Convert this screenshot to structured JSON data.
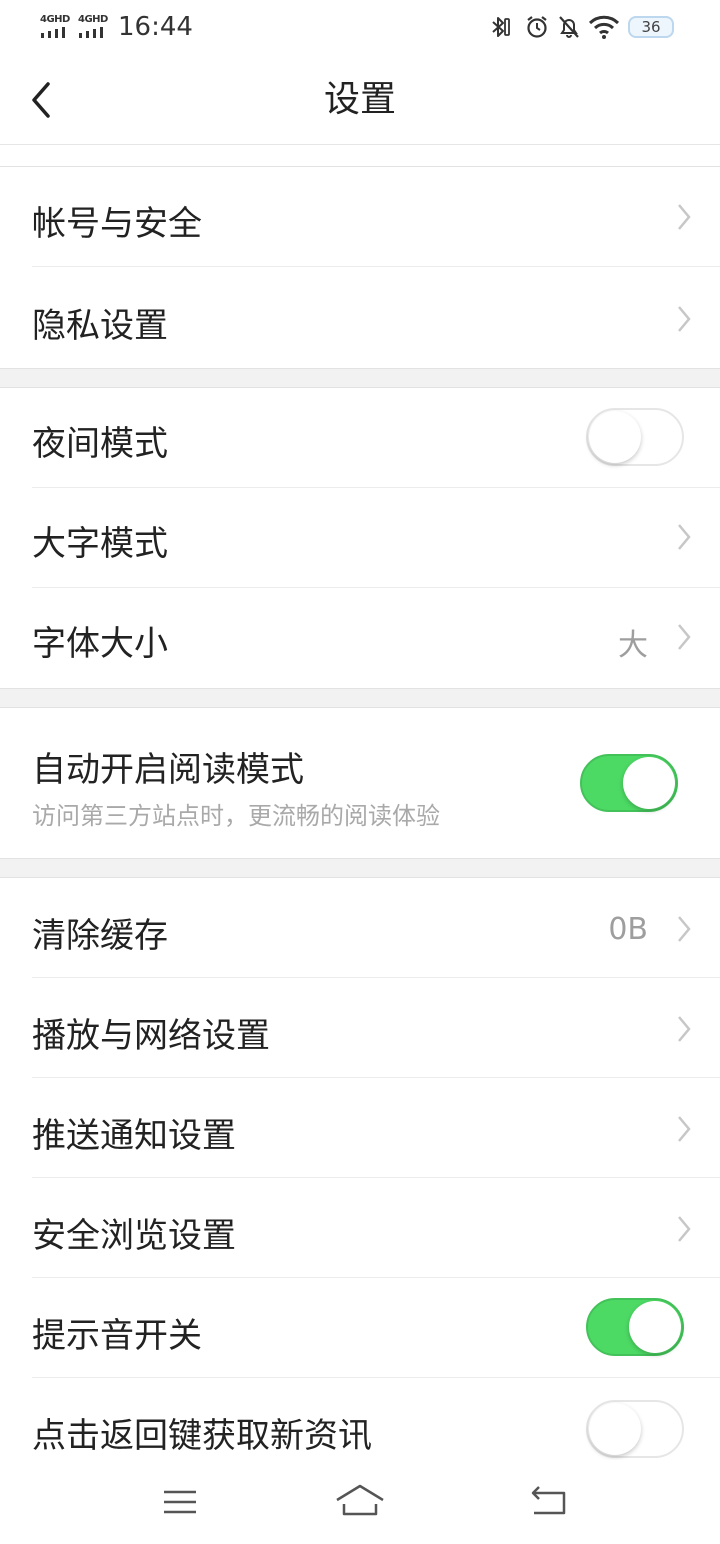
{
  "status_bar": {
    "signal_1": "4GHD",
    "signal_2": "4GHD",
    "time": "16:44",
    "battery": "36",
    "icons": [
      "bluetooth-icon",
      "alarm-icon",
      "bell-off-icon",
      "wifi-icon"
    ]
  },
  "header": {
    "title": "设置",
    "back_icon": "chevron-left-icon"
  },
  "groups": {
    "account": {
      "account_security": "帐号与安全",
      "privacy": "隐私设置"
    },
    "display": {
      "night_mode": {
        "label": "夜间模式",
        "enabled": false
      },
      "large_text": "大字模式",
      "font_size": {
        "label": "字体大小",
        "value": "大"
      }
    },
    "reading": {
      "auto_reader": {
        "label": "自动开启阅读模式",
        "description": "访问第三方站点时，更流畅的阅读体验",
        "enabled": true
      }
    },
    "general": {
      "clear_cache": {
        "label": "清除缓存",
        "value": "0B"
      },
      "play_network": "播放与网络设置",
      "push_notifications": "推送通知设置",
      "safe_browsing": "安全浏览设置",
      "sound": {
        "label": "提示音开关",
        "enabled": true
      },
      "back_refresh": {
        "label": "点击返回键获取新资讯",
        "enabled": false
      }
    }
  },
  "colors": {
    "accent": "#4cd964",
    "chevron": "#c7c7c7",
    "secondary_text": "#9e9e9e",
    "group_gap": "#f2f2f2"
  },
  "system_nav": {
    "icons": [
      "menu-icon",
      "home-icon",
      "return-icon"
    ]
  }
}
